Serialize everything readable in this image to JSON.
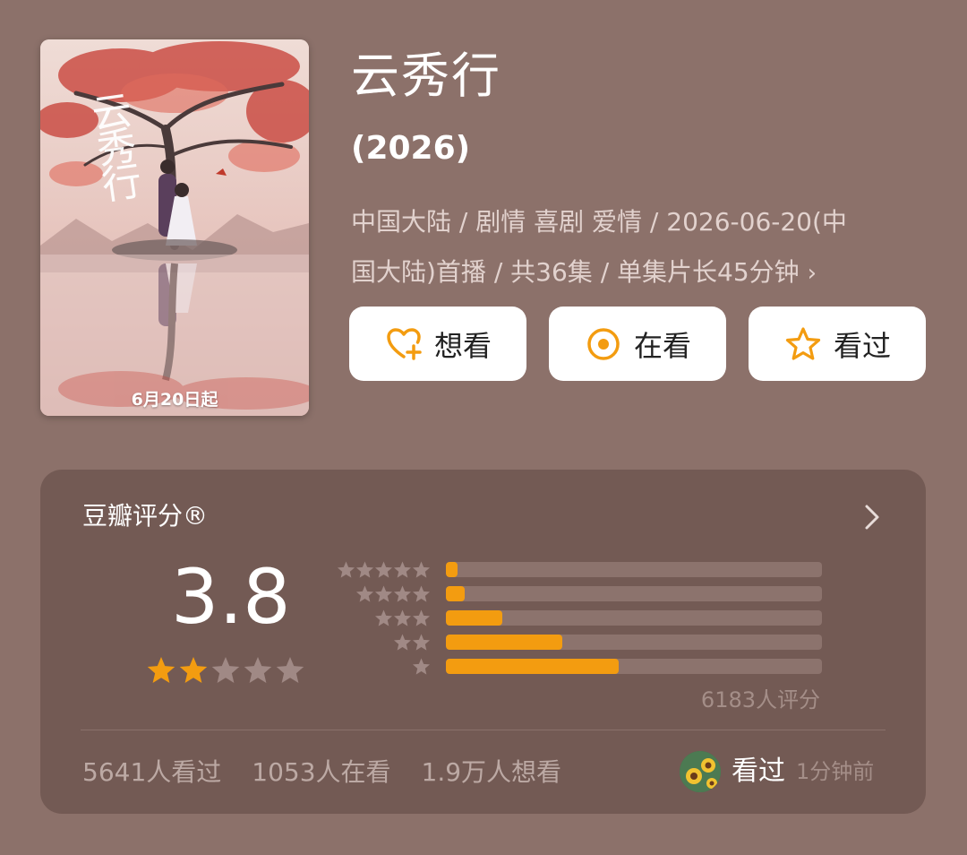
{
  "poster": {
    "title_text": "云秀行",
    "date_text": "6月20日起"
  },
  "title": "云秀行",
  "year": "(2026)",
  "meta_line1": "中国大陆 / 剧情 喜剧 爱情 / 2026-06-20(中",
  "meta_line2": "国大陆)首播 / 共36集 / 单集片长45分钟",
  "meta_chevron": "›",
  "buttons": [
    {
      "label": "想看",
      "icon": "heart-plus-icon"
    },
    {
      "label": "在看",
      "icon": "target-icon"
    },
    {
      "label": "看过",
      "icon": "star-outline-icon"
    }
  ],
  "colors": {
    "accent": "#f39c10",
    "background": "#8c716a",
    "card": "#735a54"
  },
  "rating": {
    "label": "豆瓣评分®",
    "score": "3.8",
    "stars_filled": 2,
    "stars_total": 5,
    "distribution": [
      {
        "stars": 5,
        "fraction": 0.03
      },
      {
        "stars": 4,
        "fraction": 0.05
      },
      {
        "stars": 3,
        "fraction": 0.15
      },
      {
        "stars": 2,
        "fraction": 0.31
      },
      {
        "stars": 1,
        "fraction": 0.46
      }
    ],
    "count_label": "6183人评分"
  },
  "stats": {
    "watched": "5641人看过",
    "watching": "1053人在看",
    "want": "1.9万人想看"
  },
  "friend": {
    "status": "看过",
    "time": "1分钟前"
  }
}
